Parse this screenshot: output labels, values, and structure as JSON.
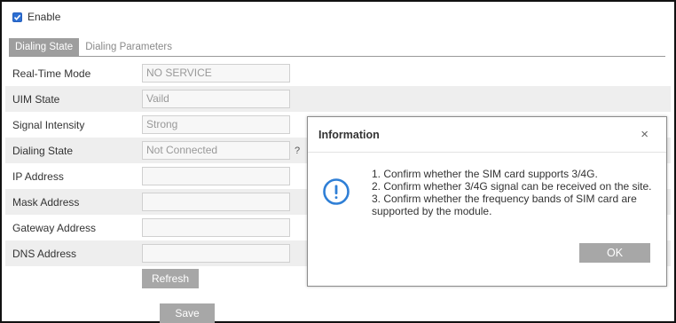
{
  "enable": {
    "label": "Enable",
    "checked": true
  },
  "tabs": [
    {
      "label": "Dialing State",
      "active": true
    },
    {
      "label": "Dialing Parameters",
      "active": false
    }
  ],
  "fields": [
    {
      "label": "Real-Time Mode",
      "value": "NO SERVICE"
    },
    {
      "label": "UIM State",
      "value": "Vaild"
    },
    {
      "label": "Signal Intensity",
      "value": "Strong"
    },
    {
      "label": "Dialing State",
      "value": "Not Connected",
      "help": "?"
    },
    {
      "label": "IP Address",
      "value": ""
    },
    {
      "label": "Mask Address",
      "value": ""
    },
    {
      "label": "Gateway Address",
      "value": ""
    },
    {
      "label": "DNS Address",
      "value": ""
    }
  ],
  "buttons": {
    "refresh": "Refresh",
    "save": "Save"
  },
  "dialog": {
    "title": "Information",
    "close": "×",
    "icon": "info-circle-icon",
    "lines": [
      "1. Confirm whether the SIM card supports 3/4G.",
      "2. Confirm whether 3/4G signal can be received on the site.",
      "3. Confirm whether the frequency bands of SIM card are supported by the module."
    ],
    "ok": "OK"
  },
  "colors": {
    "accent": "#2d6fd2",
    "button": "#a7a7a7",
    "info": "#2f7fd6"
  }
}
